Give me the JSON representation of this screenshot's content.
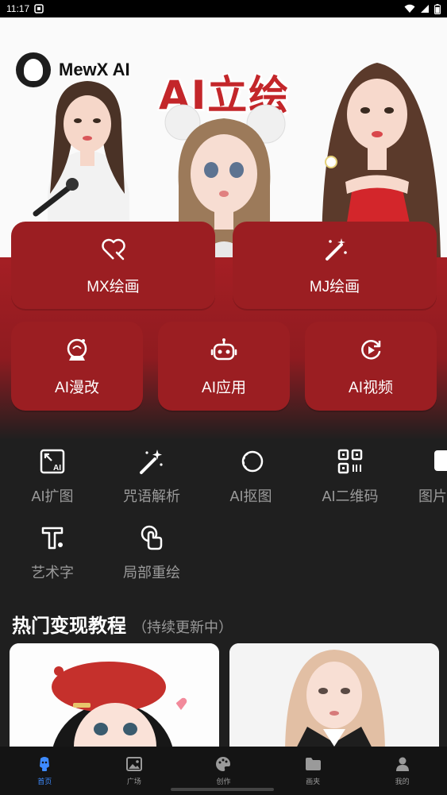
{
  "status_bar": {
    "time": "11:17"
  },
  "app": {
    "name": "MewX AI"
  },
  "banner": {
    "title": "AI立绘"
  },
  "main_cards": [
    {
      "label": "MX绘画",
      "icon": "heart-brush-icon"
    },
    {
      "label": "MJ绘画",
      "icon": "magic-wand-icon"
    }
  ],
  "sub_cards": [
    {
      "label": "AI漫改",
      "icon": "crystal-ball-icon"
    },
    {
      "label": "AI应用",
      "icon": "robot-icon"
    },
    {
      "label": "AI视频",
      "icon": "video-refresh-icon"
    }
  ],
  "tools": [
    {
      "label": "AI扩图",
      "icon": "expand-image-icon"
    },
    {
      "label": "咒语解析",
      "icon": "sparkle-wand-icon"
    },
    {
      "label": "AI抠图",
      "icon": "cutout-icon"
    },
    {
      "label": "AI二维码",
      "icon": "qr-code-icon"
    },
    {
      "label": "图片",
      "icon": "image-icon"
    },
    {
      "label": "艺术字",
      "icon": "art-text-icon"
    },
    {
      "label": "局部重绘",
      "icon": "touch-repaint-icon"
    }
  ],
  "section": {
    "title": "热门变现教程",
    "subtitle": "（持续更新中）"
  },
  "tabbar": [
    {
      "label": "首页",
      "icon": "home-icon",
      "active": true
    },
    {
      "label": "广场",
      "icon": "gallery-icon",
      "active": false
    },
    {
      "label": "创作",
      "icon": "palette-icon",
      "active": false
    },
    {
      "label": "画夹",
      "icon": "folder-icon",
      "active": false
    },
    {
      "label": "我的",
      "icon": "user-icon",
      "active": false
    }
  ],
  "colors": {
    "accent_red": "#9b1e22",
    "active_tab": "#3e8bff",
    "background": "#1f1f1f"
  }
}
